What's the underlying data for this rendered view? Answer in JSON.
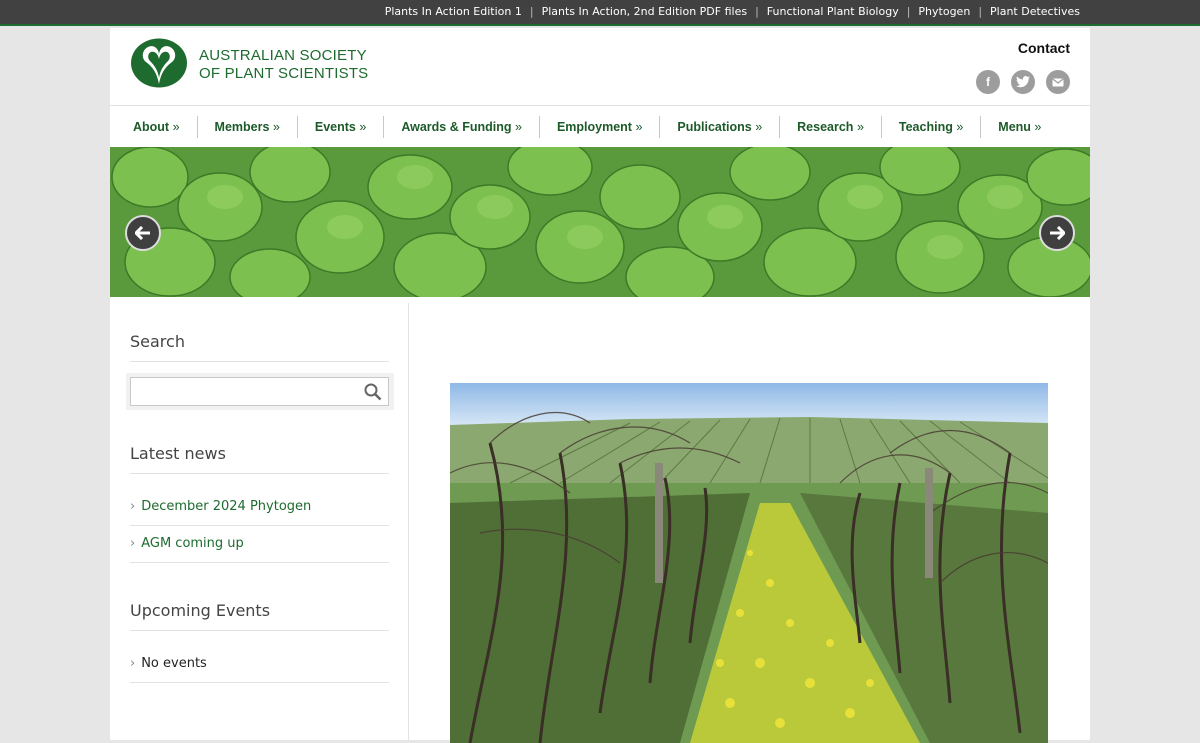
{
  "topbar": {
    "links": [
      "Plants In Action Edition 1",
      "Plants In Action, 2nd Edition PDF files",
      "Functional Plant Biology",
      "Phytogen",
      "Plant Detectives"
    ]
  },
  "header": {
    "logo_line1": "AUSTRALIAN SOCIETY",
    "logo_line2": "OF PLANT SCIENTISTS",
    "contact": "Contact",
    "social_icons": [
      "facebook-icon",
      "twitter-icon",
      "email-icon"
    ]
  },
  "nav": {
    "items": [
      "About",
      "Members",
      "Events",
      "Awards & Funding",
      "Employment",
      "Publications",
      "Research",
      "Teaching",
      "Menu"
    ],
    "suffix": "»"
  },
  "sidebar": {
    "search_title": "Search",
    "search_placeholder": "",
    "news_title": "Latest news",
    "news_items": [
      "December 2024 Phytogen",
      "AGM coming up"
    ],
    "events_title": "Upcoming Events",
    "events_empty": "No events"
  },
  "colors": {
    "brand_green": "#1d6b2e",
    "topbar_bg": "#414141",
    "page_bg": "#e6e6e6"
  }
}
